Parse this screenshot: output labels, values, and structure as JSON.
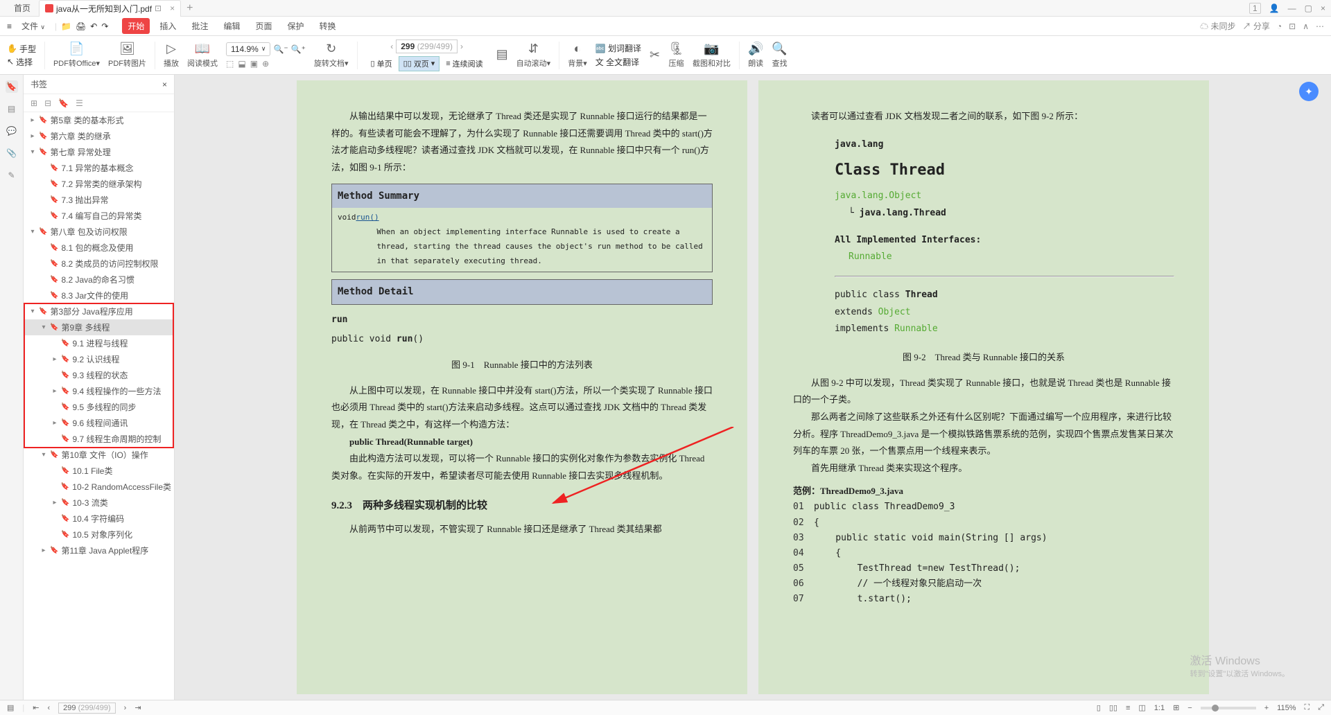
{
  "tabbar": {
    "home": "首页",
    "filename": "java从一无所知到入门.pdf",
    "pages_badge": "1"
  },
  "menubar": {
    "hamburger": "≡",
    "file": "文件",
    "start": "开始",
    "insert": "插入",
    "review": "批注",
    "edit": "编辑",
    "pagemenu": "页面",
    "protect": "保护",
    "convert": "转换",
    "sync": "未同步",
    "share": "分享"
  },
  "toolbar": {
    "hand": "手型",
    "select": "选择",
    "pdf_office": "PDF转Office",
    "pdf_img": "PDF转图片",
    "play": "播放",
    "readmode": "阅读模式",
    "zoom_value": "114.9%",
    "page_current": "299",
    "page_total": "(299/499)",
    "rotate": "旋转文档",
    "single": "单页",
    "double": "双页",
    "continuous": "连续阅读",
    "autoscroll": "自动滚动",
    "background": "背景",
    "word_trans": "划词翻译",
    "full_trans": "全文翻译",
    "compress": "压缩",
    "crop": "截图和对比",
    "readaloud": "朗读",
    "find": "查找"
  },
  "sidebar": {
    "title": "书签",
    "items": [
      {
        "level": 0,
        "exp": "▸",
        "icon": "📄",
        "text": "第5章 类的基本形式"
      },
      {
        "level": 0,
        "exp": "▸",
        "icon": "📄",
        "text": "第六章 类的继承"
      },
      {
        "level": 0,
        "exp": "▾",
        "icon": "📄",
        "text": "第七章 异常处理"
      },
      {
        "level": 1,
        "exp": "",
        "icon": "📄",
        "text": "7.1 异常的基本概念"
      },
      {
        "level": 1,
        "exp": "",
        "icon": "📄",
        "text": "7.2 异常类的继承架构"
      },
      {
        "level": 1,
        "exp": "",
        "icon": "📄",
        "text": "7.3 抛出异常"
      },
      {
        "level": 1,
        "exp": "",
        "icon": "📄",
        "text": "7.4 编写自己的异常类"
      },
      {
        "level": 0,
        "exp": "▾",
        "icon": "📄",
        "text": "第八章 包及访问权限"
      },
      {
        "level": 1,
        "exp": "",
        "icon": "📄",
        "text": "8.1 包的概念及使用"
      },
      {
        "level": 1,
        "exp": "",
        "icon": "📄",
        "text": "8.2 类成员的访问控制权限"
      },
      {
        "level": 1,
        "exp": "",
        "icon": "📄",
        "text": "8.2 Java的命名习惯"
      },
      {
        "level": 1,
        "exp": "",
        "icon": "📄",
        "text": "8.3 Jar文件的使用"
      },
      {
        "level": 0,
        "exp": "▾",
        "icon": "📄",
        "text": "第3部分 Java程序应用"
      },
      {
        "level": 1,
        "exp": "▾",
        "icon": "📄",
        "text": "第9章 多线程",
        "active": true
      },
      {
        "level": 2,
        "exp": "",
        "icon": "📄",
        "text": "9.1 进程与线程"
      },
      {
        "level": 2,
        "exp": "▸",
        "icon": "📄",
        "text": "9.2 认识线程"
      },
      {
        "level": 2,
        "exp": "",
        "icon": "📄",
        "text": "9.3 线程的状态"
      },
      {
        "level": 2,
        "exp": "▸",
        "icon": "📄",
        "text": "9.4 线程操作的一些方法"
      },
      {
        "level": 2,
        "exp": "",
        "icon": "📄",
        "text": "9.5 多线程的同步"
      },
      {
        "level": 2,
        "exp": "▸",
        "icon": "📄",
        "text": "9.6 线程间通讯"
      },
      {
        "level": 2,
        "exp": "",
        "icon": "📄",
        "text": "9.7 线程生命周期的控制"
      },
      {
        "level": 1,
        "exp": "▾",
        "icon": "📄",
        "text": "第10章 文件（IO）操作"
      },
      {
        "level": 2,
        "exp": "",
        "icon": "📄",
        "text": "10.1 File类"
      },
      {
        "level": 2,
        "exp": "",
        "icon": "📄",
        "text": "10-2 RandomAccessFile类"
      },
      {
        "level": 2,
        "exp": "▸",
        "icon": "📄",
        "text": "10-3 流类"
      },
      {
        "level": 2,
        "exp": "",
        "icon": "📄",
        "text": "10.4 字符编码"
      },
      {
        "level": 2,
        "exp": "",
        "icon": "📄",
        "text": "10.5 对象序列化"
      },
      {
        "level": 1,
        "exp": "▸",
        "icon": "📄",
        "text": "第11章 Java Applet程序"
      }
    ]
  },
  "page_left": {
    "p1": "从输出结果中可以发现，无论继承了 Thread 类还是实现了 Runnable 接口运行的结果都是一样的。有些读者可能会不理解了，为什么实现了 Runnable 接口还需要调用 Thread 类中的 start()方法才能启动多线程呢？读者通过查找 JDK 文档就可以发现，在 Runnable 接口中只有一个 run()方法，如图 9-1 所示：",
    "method_summary": "Method Summary",
    "method_type": "void",
    "method_link": "run()",
    "method_desc": "When an object implementing interface Runnable is used to create a thread, starting the thread causes the object's run method to be called in that separately executing thread.",
    "method_detail": "Method Detail",
    "run_h": "run",
    "run_sig": "public void run()",
    "fig1": "图 9-1　Runnable 接口中的方法列表",
    "p2": "从上图中可以发现，在 Runnable 接口中并没有 start()方法，所以一个类实现了 Runnable 接口也必须用 Thread 类中的 start()方法来启动多线程。这点可以通过查找 JDK 文档中的 Thread 类发现，在 Thread 类之中，有这样一个构造方法：",
    "ctor": "public Thread(Runnable target)",
    "p3": "由此构造方法可以发现，可以将一个 Runnable 接口的实例化对象作为参数去实例化 Thread 类对象。在实际的开发中，希望读者尽可能去使用 Runnable 接口去实现多线程机制。",
    "h923": "9.2.3　两种多线程实现机制的比较",
    "p4": "从前两节中可以发现，不管实现了 Runnable 接口还是继承了 Thread 类其结果都"
  },
  "page_right": {
    "p1": "读者可以通过查看 JDK 文档发现二者之间的联系，如下图 9-2 所示：",
    "jl": "java.lang",
    "classthread": "Class Thread",
    "jlo": "java.lang.Object",
    "jlt": "java.lang.Thread",
    "aii": "All Implemented Interfaces:",
    "runnable": "Runnable",
    "sig1": "public class ",
    "sig1b": "Thread",
    "sig2": "extends ",
    "sig2l": "Object",
    "sig3": "implements ",
    "sig3l": "Runnable",
    "fig2": "图 9-2　Thread 类与 Runnable 接口的关系",
    "p2": "从图 9-2 中可以发现，Thread 类实现了 Runnable 接口，也就是说 Thread 类也是 Runnable 接口的一个子类。",
    "p3": "那么两者之间除了这些联系之外还有什么区别呢？下面通过编写一个应用程序，来进行比较分析。程序 ThreadDemo9_3.java 是一个模拟铁路售票系统的范例，实现四个售票点发售某日某次列车的车票 20 张，一个售票点用一个线程来表示。",
    "p4": "首先用继承 Thread 类来实现这个程序。",
    "ex": "范例：ThreadDemo9_3.java",
    "code": [
      {
        "ln": "01",
        "t": "public class ThreadDemo9_3"
      },
      {
        "ln": "02",
        "t": "{"
      },
      {
        "ln": "03",
        "t": "    public static void main(String [] args)"
      },
      {
        "ln": "04",
        "t": "    {"
      },
      {
        "ln": "05",
        "t": "        TestThread t=new TestThread();"
      },
      {
        "ln": "06",
        "t": "        // 一个线程对象只能启动一次"
      },
      {
        "ln": "07",
        "t": "        t.start();"
      }
    ]
  },
  "watermark": {
    "l1": "激活 Windows",
    "l2": "转到\"设置\"以激活 Windows。"
  },
  "statusbar": {
    "page": "299",
    "total": "(299/499)",
    "zoom": "115%"
  }
}
